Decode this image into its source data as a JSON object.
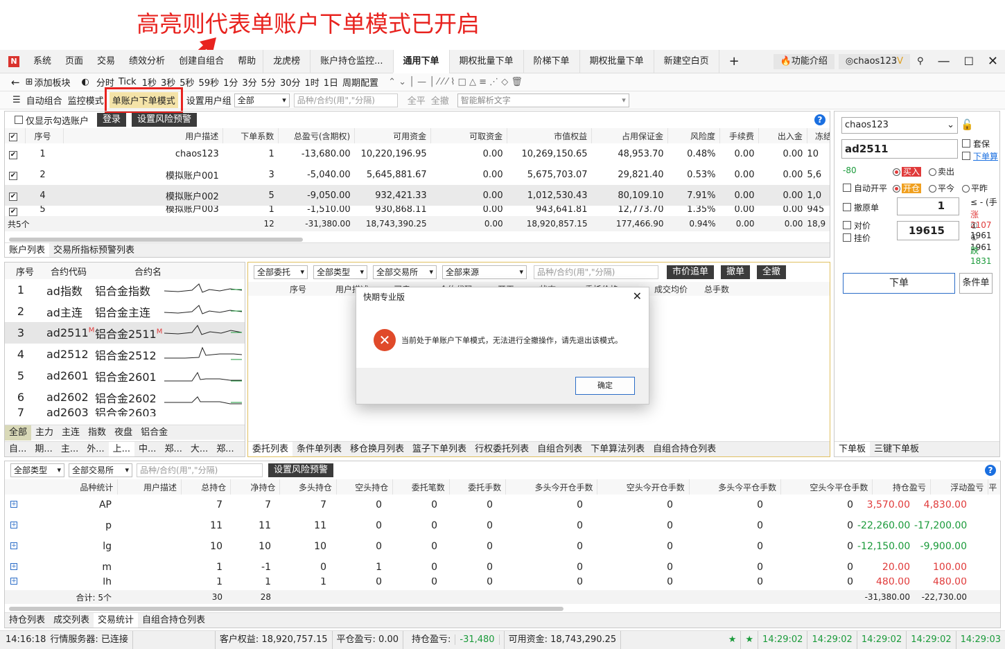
{
  "annotation": "高亮则代表单账户下单模式已开启",
  "menu": {
    "logo": "N",
    "items": [
      "系统",
      "页面",
      "交易",
      "绩效分析",
      "创建自组合",
      "帮助"
    ],
    "tabs": [
      "龙虎榜",
      "账户持仓监控...",
      "通用下单",
      "期权批量下单",
      "阶梯下单",
      "期权批量下单",
      "新建空白页"
    ],
    "active_tab": "通用下单",
    "add": "+",
    "feature_intro": "功能介绍",
    "user": "chaos123",
    "user_v": "V"
  },
  "toolbar1": {
    "add_panel": "添加板块",
    "periods": [
      "分时",
      "Tick",
      "1秒",
      "3秒",
      "5秒",
      "59秒",
      "1分",
      "3分",
      "5分",
      "30分",
      "1时",
      "1日",
      "周期配置"
    ]
  },
  "toolbar2": {
    "auto_combo": "自动组合",
    "monitor_mode": "监控模式",
    "single_account_mode": "单账户下单模式",
    "set_user_group": "设置用户组",
    "group_value": "全部",
    "contract_placeholder": "品种/合约(用\",\"分隔)",
    "all_close": "全平",
    "all_cancel": "全撤",
    "smart_parse": "智能解析文字"
  },
  "accounts": {
    "show_checked": "仅显示勾选账户",
    "login": "登录",
    "risk_warning": "设置风险预警",
    "columns": [
      "序号",
      "用户描述",
      "下单系数",
      "总盈亏(含期权)",
      "可用资金",
      "可取资金",
      "市值权益",
      "占用保证金",
      "风险度",
      "手续费",
      "出入金",
      "冻结"
    ],
    "rows": [
      {
        "no": "1",
        "name": "chaos123",
        "coef": "1",
        "pnl": "-13,680.00",
        "avail": "10,220,196.95",
        "withdraw": "0.00",
        "equity": "10,269,150.65",
        "margin": "48,953.70",
        "risk": "0.48%",
        "fee": "0.00",
        "io": "0.00",
        "x": "10"
      },
      {
        "no": "2",
        "name": "模拟账户001",
        "coef": "3",
        "pnl": "-5,040.00",
        "avail": "5,645,881.67",
        "withdraw": "0.00",
        "equity": "5,675,703.07",
        "margin": "29,821.40",
        "risk": "0.53%",
        "fee": "0.00",
        "io": "0.00",
        "x": "5,6"
      },
      {
        "no": "4",
        "name": "模拟账户002",
        "coef": "5",
        "pnl": "-9,050.00",
        "avail": "932,421.33",
        "withdraw": "0.00",
        "equity": "1,012,530.43",
        "margin": "80,109.10",
        "risk": "7.91%",
        "fee": "0.00",
        "io": "0.00",
        "x": "1,0"
      },
      {
        "no": "5",
        "name": "模拟账户003",
        "coef": "1",
        "pnl": "-1,510.00",
        "avail": "930,868.11",
        "withdraw": "0.00",
        "equity": "943,641.81",
        "margin": "12,773.70",
        "risk": "1.35%",
        "fee": "0.00",
        "io": "0.00",
        "x": "945"
      }
    ],
    "total": {
      "label": "共5个",
      "coef": "12",
      "pnl": "-31,380.00",
      "avail": "18,743,390.25",
      "withdraw": "0.00",
      "equity": "18,920,857.15",
      "margin": "177,466.90",
      "risk": "0.94%",
      "fee": "0.00",
      "io": "0.00",
      "x": "18,9"
    },
    "tabs": [
      "账户列表",
      "交易所指标预警列表"
    ]
  },
  "contracts": {
    "columns": [
      "序号",
      "合约代码",
      "合约名"
    ],
    "rows": [
      {
        "no": "1",
        "code": "ad指数",
        "name": "铝合金指数",
        "m": ""
      },
      {
        "no": "2",
        "code": "ad主连",
        "name": "铝合金主连",
        "m": ""
      },
      {
        "no": "3",
        "code": "ad2511",
        "name": "铝合金2511",
        "m": "M"
      },
      {
        "no": "4",
        "code": "ad2512",
        "name": "铝合金2512",
        "m": ""
      },
      {
        "no": "5",
        "code": "ad2601",
        "name": "铝合金2601",
        "m": ""
      },
      {
        "no": "6",
        "code": "ad2602",
        "name": "铝合金2602",
        "m": ""
      },
      {
        "no": "7",
        "code": "ad2603",
        "name": "铝合金2603",
        "m": ""
      }
    ],
    "tabs1": [
      "全部",
      "主力",
      "主连",
      "指数",
      "夜盘",
      "铝合金"
    ],
    "tabs2": [
      "自...",
      "期...",
      "主...",
      "外...",
      "上...",
      "中...",
      "郑...",
      "大...",
      "郑..."
    ]
  },
  "orders": {
    "filters": [
      "全部委托",
      "全部类型",
      "全部交易所",
      "全部来源"
    ],
    "placeholder": "品种/合约(用\",\"分隔)",
    "market_chase": "市价追单",
    "cancel": "撤单",
    "cancel_all": "全撤",
    "columns": [
      "序号",
      "用户描述",
      "买卖",
      "合约代码",
      "开平",
      "状态",
      "委托价格",
      "成交均价",
      "总手数"
    ],
    "tabs": [
      "委托列表",
      "条件单列表",
      "移仓换月列表",
      "篮子下单列表",
      "行权委托列表",
      "自组合列表",
      "下单算法列表",
      "自组合持仓列表"
    ]
  },
  "dialog": {
    "title": "快期专业版",
    "message": "当前处于单账户下单模式，无法进行全撤操作，请先退出该模式。",
    "ok": "确定"
  },
  "order_panel": {
    "account": "chaos123",
    "contract": "ad2511",
    "hedge": "套保",
    "order_calc": "下单算",
    "price_diff": "-80",
    "buy": "买入",
    "sell": "卖出",
    "auto_open_close": "自动开平",
    "open": "开仓",
    "close_today": "平今",
    "close": "平昨",
    "cancel_order": "撤原单",
    "qty": "1",
    "qty_hint": "≤ - (手",
    "limit_up": "涨 2107",
    "counter_price": "对价",
    "hang_price": "挂价",
    "price": "19615",
    "bid1": "① 1961",
    "ask1": "① 1961",
    "limit_down": "跌 1831",
    "place_order": "下单",
    "conditional": "条件单",
    "tabs": [
      "下单板",
      "三键下单板"
    ]
  },
  "positions": {
    "filters": [
      "全部类型",
      "全部交易所"
    ],
    "placeholder": "品种/合约(用\",\"分隔)",
    "risk_warning": "设置风险预警",
    "columns": [
      "品种统计",
      "用户描述",
      "总持仓",
      "净持仓",
      "多头持仓",
      "空头持仓",
      "委托笔数",
      "委托手数",
      "多头今开仓手数",
      "空头今开仓手数",
      "多头今平仓手数",
      "空头今平仓手数",
      "持仓盈亏",
      "浮动盈亏",
      "平"
    ],
    "rows": [
      {
        "sym": "AP",
        "total": "7",
        "net": "7",
        "long": "7",
        "short": "0",
        "cnt": "0",
        "lots": "0",
        "lo": "0",
        "so": "0",
        "lc": "0",
        "sc": "0",
        "pnl": "3,570.00",
        "float": "4,830.00",
        "pc": "red",
        "fc": "red"
      },
      {
        "sym": "p",
        "total": "11",
        "net": "11",
        "long": "11",
        "short": "0",
        "cnt": "0",
        "lots": "0",
        "lo": "0",
        "so": "0",
        "lc": "0",
        "sc": "0",
        "pnl": "-22,260.00",
        "float": "-17,200.00",
        "pc": "green",
        "fc": "green"
      },
      {
        "sym": "lg",
        "total": "10",
        "net": "10",
        "long": "10",
        "short": "0",
        "cnt": "0",
        "lots": "0",
        "lo": "0",
        "so": "0",
        "lc": "0",
        "sc": "0",
        "pnl": "-12,150.00",
        "float": "-9,900.00",
        "pc": "green",
        "fc": "green"
      },
      {
        "sym": "m",
        "total": "1",
        "net": "-1",
        "long": "0",
        "short": "1",
        "cnt": "0",
        "lots": "0",
        "lo": "0",
        "so": "0",
        "lc": "0",
        "sc": "0",
        "pnl": "20.00",
        "float": "100.00",
        "pc": "red",
        "fc": "red"
      },
      {
        "sym": "lh",
        "total": "1",
        "net": "1",
        "long": "1",
        "short": "0",
        "cnt": "0",
        "lots": "0",
        "lo": "0",
        "so": "0",
        "lc": "0",
        "sc": "0",
        "pnl": "480.00",
        "float": "480.00",
        "pc": "red",
        "fc": "red"
      }
    ],
    "total": {
      "label": "合计: 5个",
      "total": "30",
      "net": "28",
      "pnl": "-31,380.00",
      "float": "-22,730.00"
    },
    "tabs": [
      "持仓列表",
      "成交列表",
      "交易统计",
      "自组合持仓列表"
    ]
  },
  "status": {
    "time": "14:16:18",
    "server": "行情服务器: 已连接",
    "equity": "客户权益: 18,920,757.15",
    "close_pnl": "平仓盈亏: 0.00",
    "pos_pnl_label": "持仓盈亏:",
    "pos_pnl": "-31,480",
    "avail": "可用资金: 18,743,290.25",
    "clocks": [
      "14:29:02",
      "14:29:02",
      "14:29:02",
      "14:29:02",
      "14:29:03"
    ]
  },
  "colors": {
    "accent": "#d9332d",
    "green": "#1a9a3a",
    "red": "#e03a3a",
    "highlight": "#f4e3a8"
  }
}
